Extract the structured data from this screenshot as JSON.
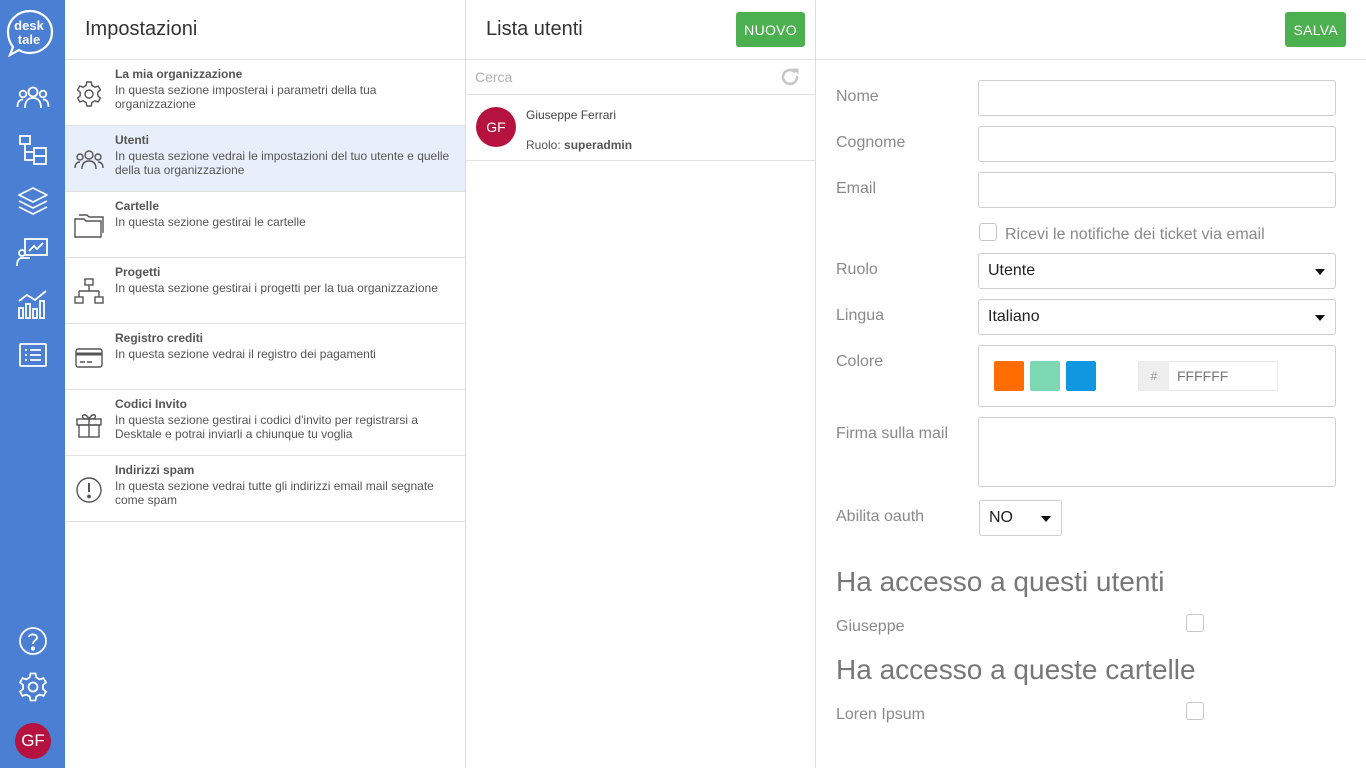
{
  "rail": {
    "logo_line1": "desk",
    "logo_line2": "tale",
    "avatar_initials": "GF",
    "icons": [
      "users-icon",
      "folders-icon",
      "layers-icon",
      "presentation-chart-icon",
      "analytics-icon",
      "list-icon",
      "help-icon",
      "gear-icon"
    ]
  },
  "settings": {
    "title": "Impostazioni",
    "items": [
      {
        "title": "La mia organizzazione",
        "desc": "In questa sezione imposterai i parametri della tua organizzazione",
        "icon": "gear-icon",
        "active": false
      },
      {
        "title": "Utenti",
        "desc": "In questa sezione vedrai le impostazioni del tuo utente e quelle della tua organizzazione",
        "icon": "users-icon",
        "active": true
      },
      {
        "title": "Cartelle",
        "desc": "In questa sezione gestirai le cartelle",
        "icon": "folder-icon",
        "active": false
      },
      {
        "title": "Progetti",
        "desc": "In questa sezione gestirai i progetti per la tua organizzazione",
        "icon": "sitemap-icon",
        "active": false
      },
      {
        "title": "Registro crediti",
        "desc": "In questa sezione vedrai il registro dei pagamenti",
        "icon": "credit-card-icon",
        "active": false
      },
      {
        "title": "Codici Invito",
        "desc": "In questa sezione gestirai i codici d'invito per registrarsi a Desktale e potrai inviarli a chiunque tu voglia",
        "icon": "gift-icon",
        "active": false
      },
      {
        "title": "Indirizzi spam",
        "desc": "In questa sezione vedrai tutte gli indirizzi email mail segnate come spam",
        "icon": "alert-icon",
        "active": false
      }
    ]
  },
  "users": {
    "title": "Lista utenti",
    "new_label": "NUOVO",
    "search_placeholder": "Cerca",
    "list": [
      {
        "initials": "GF",
        "name": "Giuseppe Ferrari",
        "role_label": "Ruolo:",
        "role": "superadmin"
      }
    ]
  },
  "form": {
    "save_label": "SALVA",
    "nome_label": "Nome",
    "nome_value": "",
    "cognome_label": "Cognome",
    "cognome_value": "",
    "email_label": "Email",
    "email_value": "",
    "notify_label": "Ricevi le notifiche dei ticket via email",
    "ruolo_label": "Ruolo",
    "ruolo_value": "Utente",
    "lingua_label": "Lingua",
    "lingua_value": "Italiano",
    "colore_label": "Colore",
    "swatches": [
      "#ff6d00",
      "#7dd9b4",
      "#1196e0"
    ],
    "hex_prefix": "#",
    "hex_placeholder": "FFFFFF",
    "firma_label": "Firma sulla mail",
    "oauth_label": "Abilita oauth",
    "oauth_value": "NO",
    "users_access_heading": "Ha accesso a questi utenti",
    "users_access": [
      {
        "name": "Giuseppe"
      }
    ],
    "folders_access_heading": "Ha accesso a queste cartelle",
    "folders_access": [
      {
        "name": "Loren Ipsum"
      }
    ]
  },
  "colors": {
    "rail_bg": "#4a7fd4",
    "accent_green": "#4caf50",
    "avatar_bg": "#b5123f",
    "active_row": "#e8effa"
  }
}
